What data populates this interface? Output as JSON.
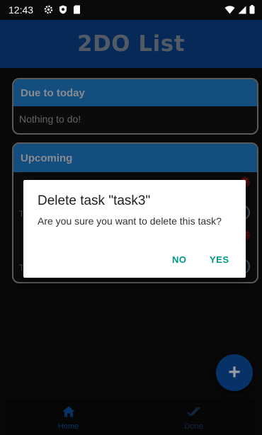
{
  "status_bar": {
    "time": "12:43"
  },
  "app": {
    "title": "2DO List"
  },
  "due_today": {
    "header": "Due to today",
    "empty_text": "Nothing to do!"
  },
  "upcoming": {
    "header": "Upcoming",
    "task_letter_1": "T",
    "task_letter_2": "T"
  },
  "dialog": {
    "title": "Delete task \"task3\"",
    "message": "Are you sure you want to delete this task?",
    "no_label": "NO",
    "yes_label": "YES"
  },
  "fab": {
    "label": "+"
  },
  "bottom_nav": {
    "home_label": "Home",
    "done_label": "Done"
  },
  "colors": {
    "appbar": "#0b3f86",
    "card_header": "#1f78c2",
    "accent": "#009688",
    "fab": "#0a4da0"
  },
  "icons": [
    "settings-icon",
    "shield-icon",
    "sd-card-icon",
    "wifi-icon",
    "signal-icon",
    "battery-icon",
    "home-icon",
    "done-all-icon",
    "plus-icon",
    "close-icon",
    "check-circle-icon"
  ]
}
